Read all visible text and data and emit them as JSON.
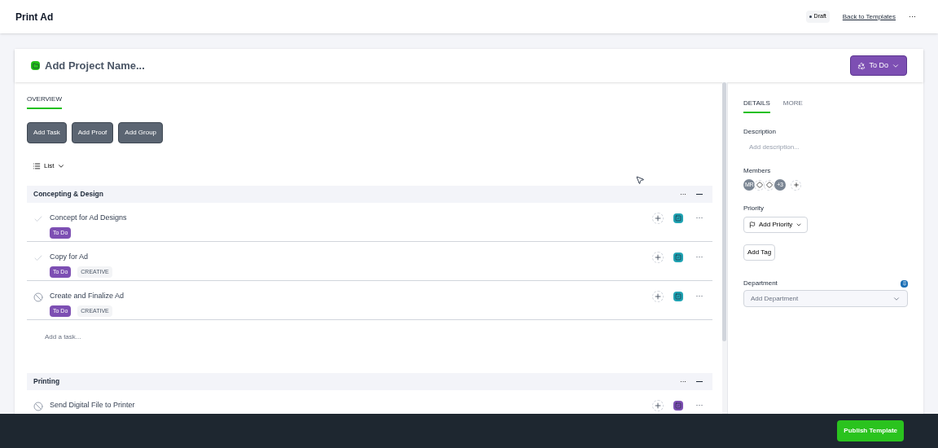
{
  "header": {
    "title": "Print Ad",
    "badge": "Draft",
    "link": "Back to Templates",
    "more": "···"
  },
  "project": {
    "name": "Add Project Name...",
    "status": "To Do"
  },
  "tabs": [
    {
      "label": "OVERVIEW",
      "selected": true
    }
  ],
  "actions": [
    "Add Task",
    "Add Proof",
    "Add Group"
  ],
  "view": "List",
  "groups": [
    {
      "name": "Concepting & Design",
      "more": "···",
      "tasks": [
        {
          "title": "Concept for Ad Designs",
          "kind": "check",
          "color": "#1fa3b3",
          "more": "···",
          "tags": [
            {
              "label": "To Do",
              "kind": "status"
            }
          ]
        },
        {
          "title": "Copy for Ad",
          "kind": "check",
          "color": "#1fa3b3",
          "more": "···",
          "tags": [
            {
              "label": "To Do",
              "kind": "status"
            },
            {
              "label": "CREATIVE",
              "kind": "tag"
            }
          ]
        },
        {
          "title": "Create and Finalize Ad",
          "kind": "blocked",
          "color": "#1fa3b3",
          "more": "···",
          "tags": [
            {
              "label": "To Do",
              "kind": "status"
            },
            {
              "label": "CREATIVE",
              "kind": "tag"
            }
          ]
        }
      ],
      "add_placeholder": "Add a task..."
    },
    {
      "name": "Printing",
      "more": "···",
      "tasks": [
        {
          "title": "Send Digital File to Printer",
          "kind": "blocked",
          "color": "#7d4fb3",
          "more": "···"
        }
      ]
    }
  ],
  "side_tabs": [
    {
      "label": "DETAILS",
      "selected": true
    },
    {
      "label": "MORE",
      "selected": false
    }
  ],
  "description": {
    "label": "Description",
    "placeholder": "Add description..."
  },
  "members": {
    "label": "Members",
    "avatars": [
      {
        "kind": "initials",
        "text": "MR"
      },
      {
        "kind": "empty"
      },
      {
        "kind": "empty"
      },
      {
        "kind": "count",
        "text": "+3"
      }
    ]
  },
  "priority": {
    "label": "Priority",
    "button": "Add Priority"
  },
  "tag_button": "Add Tag",
  "department": {
    "label": "Department",
    "placeholder": "Add Department"
  },
  "footer": {
    "button": "Publish Template"
  }
}
